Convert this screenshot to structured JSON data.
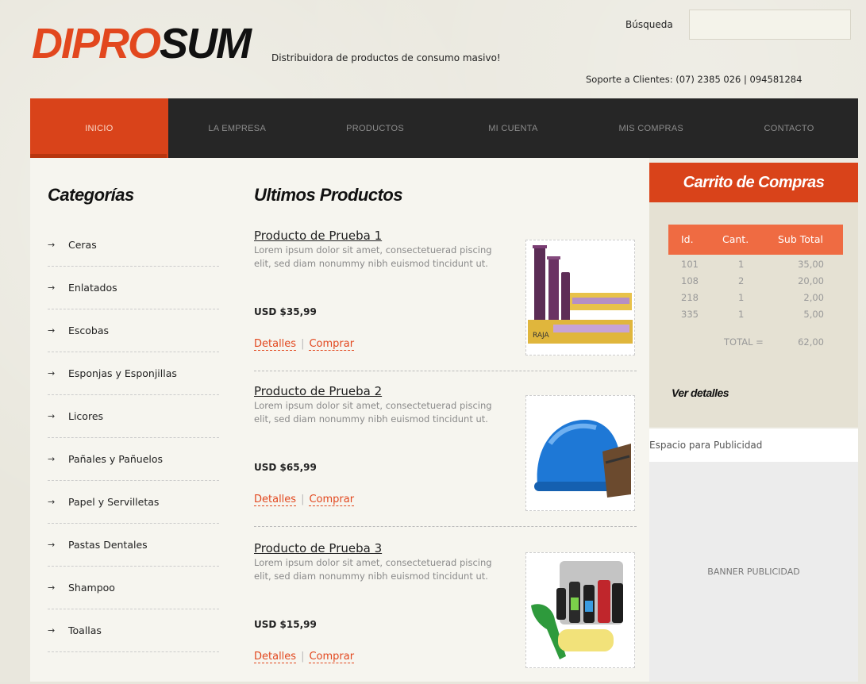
{
  "header": {
    "logo_part1": "DIPRO",
    "logo_part2": "SUM",
    "tagline": "Distribuidora de productos de consumo masivo!",
    "search_label": "Búsqueda",
    "search_value": "",
    "support": "Soporte a Clientes: (07) 2385 026 | 094581284"
  },
  "nav": {
    "items": [
      {
        "label": "INICIO",
        "active": true
      },
      {
        "label": "LA EMPRESA"
      },
      {
        "label": "PRODUCTOS"
      },
      {
        "label": "MI CUENTA"
      },
      {
        "label": "MIS COMPRAS"
      },
      {
        "label": "CONTACTO"
      }
    ]
  },
  "categories": {
    "title": "Categorías",
    "arrow": "→",
    "items": [
      "Ceras",
      "Enlatados",
      "Escobas",
      "Esponjas y Esponjillas",
      "Licores",
      "Pañales y Pañuelos",
      "Papel y Servilletas",
      "Pastas Dentales",
      "Shampoo",
      "Toallas"
    ]
  },
  "products": {
    "title": "Ultimos Productos",
    "items": [
      {
        "name": "Producto de Prueba 1",
        "description": "Lorem ipsum dolor sit amet, consectetuerad piscing elit, sed diam nonummy nibh euismod tincidunt ut.",
        "price": "USD $35,99",
        "details_label": "Detalles",
        "separator": "|",
        "buy_label": "Comprar",
        "image": "plastic-wrap-rolls"
      },
      {
        "name": "Producto de Prueba 2",
        "description": "Lorem ipsum dolor sit amet, consectetuerad piscing elit, sed diam nonummy nibh euismod tincidunt ut.",
        "price": "USD $65,99",
        "details_label": "Detalles",
        "separator": "|",
        "buy_label": "Comprar",
        "image": "blue-hard-hat"
      },
      {
        "name": "Producto de Prueba 3",
        "description": "Lorem ipsum dolor sit amet, consectetuerad piscing elit, sed diam nonummy nibh euismod tincidunt ut.",
        "price": "USD $15,99",
        "details_label": "Detalles",
        "separator": "|",
        "buy_label": "Comprar",
        "image": "car-care-kit"
      }
    ]
  },
  "cart": {
    "title": "Carrito de Compras",
    "columns": [
      "Id.",
      "Cant.",
      "Sub Total"
    ],
    "rows": [
      {
        "id": "101",
        "qty": "1",
        "subtotal": "35,00"
      },
      {
        "id": "108",
        "qty": "2",
        "subtotal": "20,00"
      },
      {
        "id": "218",
        "qty": "1",
        "subtotal": "2,00"
      },
      {
        "id": "335",
        "qty": "1",
        "subtotal": "5,00"
      }
    ],
    "total_label": "TOTAL =",
    "total_value": "62,00",
    "view_details": "Ver detalles"
  },
  "ads": {
    "label": "Espacio para Publicidad",
    "banner": "BANNER PUBLICIDAD"
  },
  "colors": {
    "accent": "#d9431a",
    "nav_bg": "#262626",
    "link": "#e2471e"
  }
}
